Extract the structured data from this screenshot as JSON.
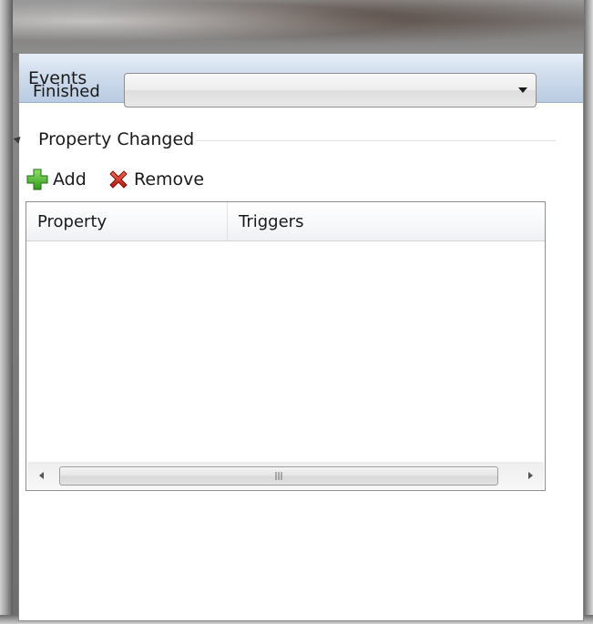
{
  "panel": {
    "title": "Events"
  },
  "finished": {
    "label": "Finished",
    "value": ""
  },
  "section": {
    "title": "Property Changed"
  },
  "toolbar": {
    "add_label": "Add",
    "remove_label": "Remove"
  },
  "grid": {
    "columns": [
      "Property",
      "Triggers"
    ],
    "rows": []
  },
  "icons": {
    "add": "plus-icon",
    "remove": "x-icon",
    "expand": "triangle-expanded-icon"
  },
  "colors": {
    "header_blue": "#cfdcec",
    "add_green": "#3fa52b",
    "remove_red": "#d52b1e"
  }
}
